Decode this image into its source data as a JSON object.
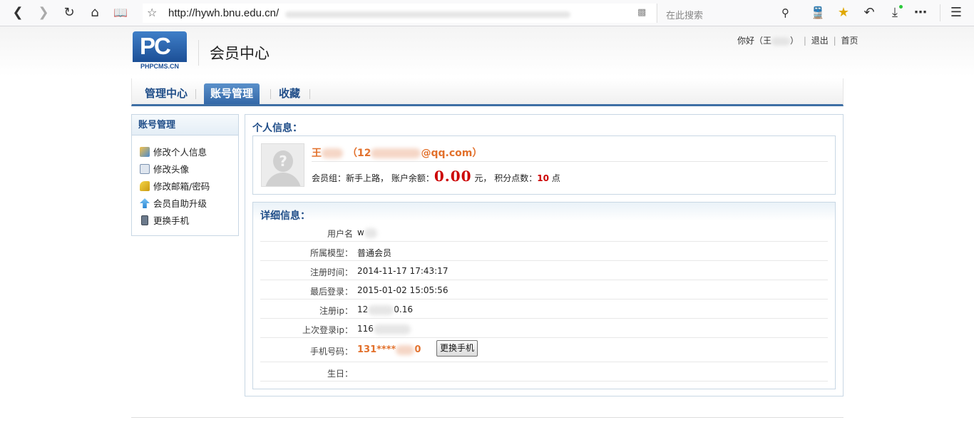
{
  "browser": {
    "url": "http://hywh.bnu.edu.cn/",
    "search_placeholder": "在此搜索"
  },
  "header": {
    "logo_text": "PC",
    "logo_sub": "PHPCMS.CN",
    "title": "会员中心",
    "greeting_prefix": "你好（王",
    "greeting_suffix": "）",
    "logout": "退出",
    "home": "首页"
  },
  "nav": {
    "tabs": [
      {
        "label": "管理中心"
      },
      {
        "label": "账号管理"
      },
      {
        "label": "收藏"
      }
    ],
    "active_index": 1
  },
  "sidebar": {
    "title": "账号管理",
    "items": [
      {
        "label": "修改个人信息",
        "icon": "user-edit-icon"
      },
      {
        "label": "修改头像",
        "icon": "id-card-icon"
      },
      {
        "label": "修改邮箱/密码",
        "icon": "key-icon"
      },
      {
        "label": "会员自助升级",
        "icon": "upgrade-arrow-icon"
      },
      {
        "label": "更换手机",
        "icon": "mobile-phone-icon"
      }
    ]
  },
  "personal": {
    "section_title": "个人信息：",
    "name_prefix": "王",
    "email_prefix": "（12",
    "email_suffix": "@qq.com）",
    "group_label": "会员组：",
    "group_value": "新手上路",
    "balance_label": "，  账户余额：",
    "balance_value": "0.00",
    "balance_unit": "元，  积分点数：",
    "points_value": "10",
    "points_unit": "点"
  },
  "detail": {
    "section_title": "详细信息：",
    "rows": [
      {
        "label": "用户名",
        "value": "w"
      },
      {
        "label": "所属模型：",
        "value": "普通会员"
      },
      {
        "label": "注册时间：",
        "value": "2014-11-17 17:43:17"
      },
      {
        "label": "最后登录：",
        "value": "2015-01-02 15:05:56"
      },
      {
        "label": "注册ip：",
        "value_prefix": "12",
        "value_suffix": "0.16"
      },
      {
        "label": "上次登录ip：",
        "value_prefix": "116"
      },
      {
        "label": "手机号码：",
        "value_prefix": "131****",
        "value_suffix": "0",
        "button": "更换手机"
      },
      {
        "label": "生日：",
        "value": ""
      }
    ]
  },
  "colors": {
    "accent": "#3e6fa5",
    "title_blue": "#1f4d88",
    "orange": "#e2702b",
    "red": "#cc0000"
  }
}
